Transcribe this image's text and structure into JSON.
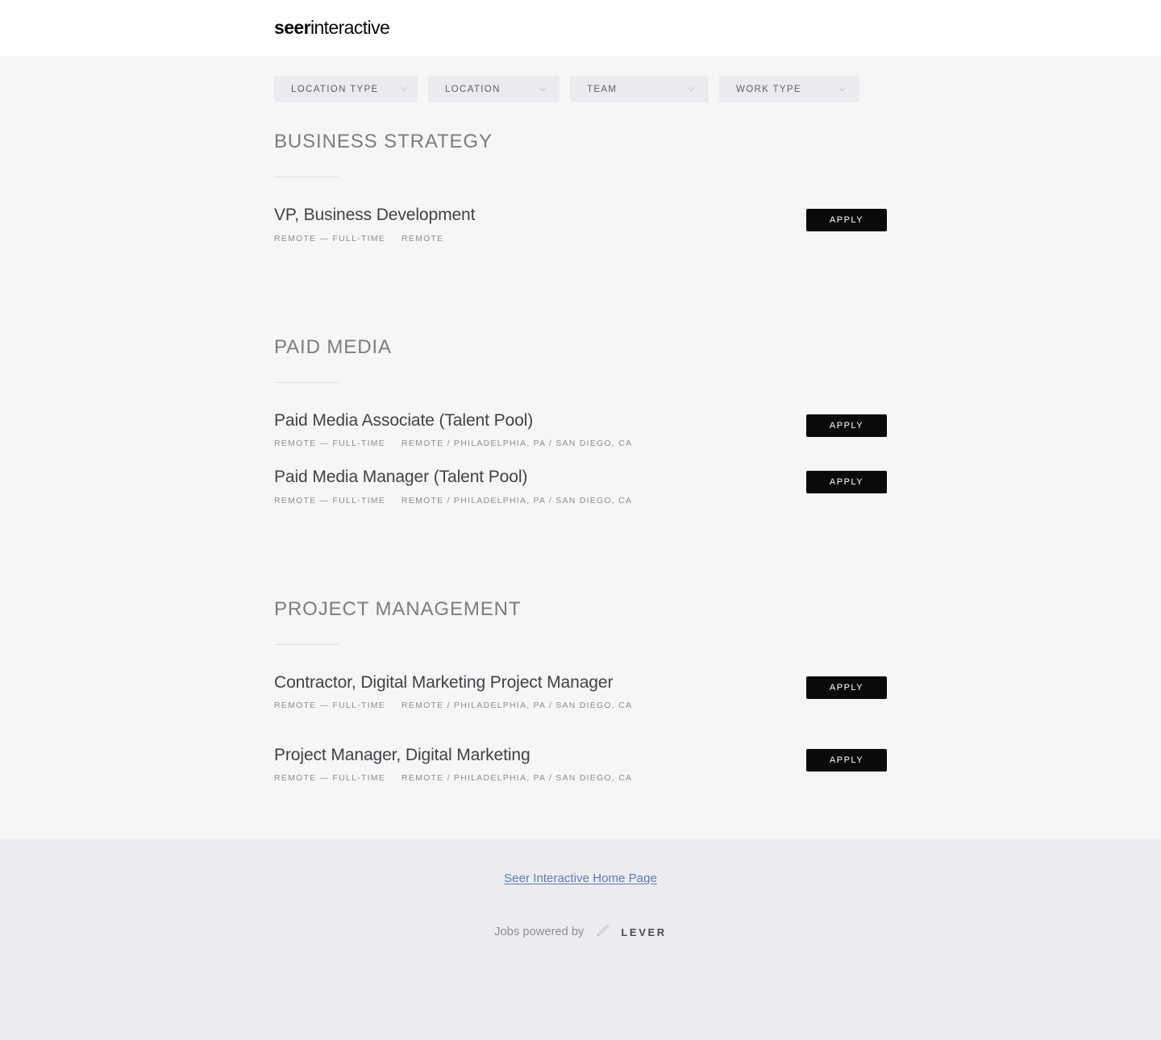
{
  "header": {
    "logo_bold": "seer",
    "logo_light": "interactive"
  },
  "filters": [
    {
      "label": "Location Type",
      "icon": "chevron-down-icon",
      "name": "location-type"
    },
    {
      "label": "Location",
      "icon": "chevron-down-icon",
      "name": "location"
    },
    {
      "label": "Team",
      "icon": "chevron-down-icon",
      "name": "team"
    },
    {
      "label": "Work Type",
      "icon": "chevron-down-icon",
      "name": "work-type"
    }
  ],
  "apply_label": "Apply",
  "sections": [
    {
      "title": "Business Strategy",
      "postings": [
        {
          "title": "VP, Business Development",
          "commitment": "Remote — Full-time",
          "location": "Remote"
        }
      ]
    },
    {
      "title": "Paid Media",
      "postings": [
        {
          "title": "Paid Media Associate (Talent Pool)",
          "commitment": "Remote — Full-time",
          "location": "Remote / Philadelphia, PA / San Diego, CA"
        },
        {
          "title": "Paid Media Manager (Talent Pool)",
          "commitment": "Remote — Full-time",
          "location": "Remote / Philadelphia, PA / San Diego, CA"
        }
      ]
    },
    {
      "title": "Project Management",
      "postings": [
        {
          "title": "Contractor, Digital Marketing Project Manager",
          "commitment": "Remote — Full-time",
          "location": "Remote / Philadelphia, PA / San Diego, CA"
        },
        {
          "title": "Project Manager, Digital Marketing",
          "commitment": "Remote — Full-time",
          "location": "Remote / Philadelphia, PA / San Diego, CA"
        }
      ]
    }
  ],
  "footer": {
    "home_link": "Seer Interactive Home Page",
    "powered_text": "Jobs powered by",
    "lever_wordmark": "LEVER",
    "lever_icon": "lever-logo-icon"
  },
  "colors": {
    "page_bg": "#f6f6f6",
    "header_bg": "#ffffff",
    "footer_bg": "#ececf0",
    "filter_bg": "#ebebef",
    "apply_bg": "#0a0a0a",
    "link": "#5a7ab5",
    "section_title": "#7c7c82",
    "posting_title": "#3f4246",
    "meta_text": "#8d8d93"
  }
}
